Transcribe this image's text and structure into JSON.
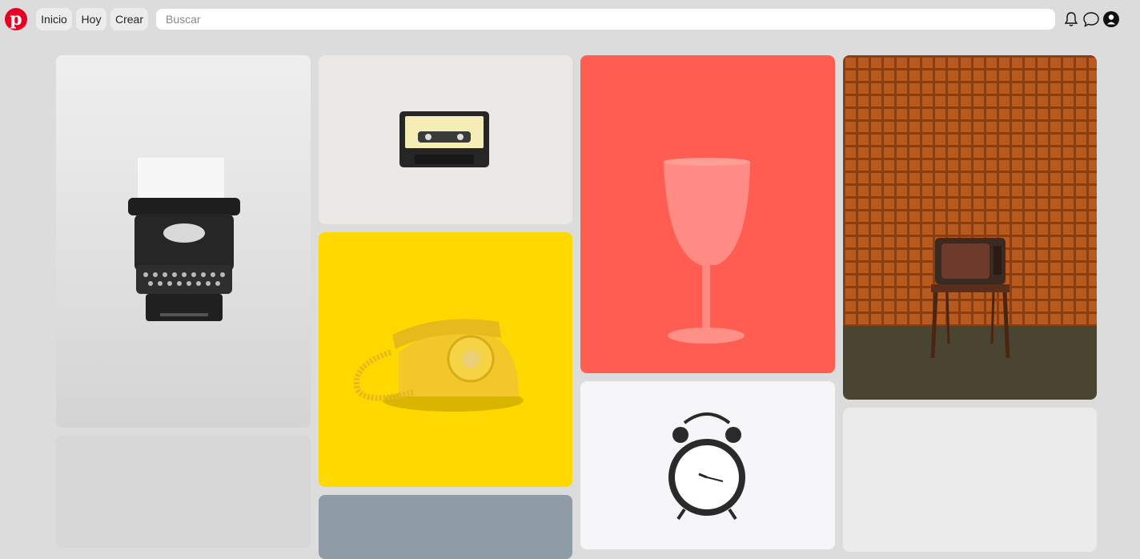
{
  "header": {
    "logo_letter": "p",
    "nav": [
      {
        "label": "Inicio"
      },
      {
        "label": "Hoy"
      },
      {
        "label": "Crear"
      }
    ],
    "search": {
      "placeholder": "Buscar",
      "value": ""
    },
    "icons": [
      "bell-icon",
      "chat-bubble-icon",
      "profile-avatar-icon"
    ]
  },
  "pins": [
    {
      "subject": "typewriter",
      "color": "#e6e6e6"
    },
    {
      "subject": "cassette-tape",
      "color": "#ece9e7"
    },
    {
      "subject": "yellow-rotary-phone",
      "color": "#ffd800"
    },
    {
      "subject": "pink-wine-glass",
      "color": "#ff5d52"
    },
    {
      "subject": "retro-tv-on-chair",
      "color": "#b55a20"
    },
    {
      "subject": "alarm-clock",
      "color": "#f6f6f8"
    },
    {
      "subject": "light-grey",
      "color": "#dadada"
    },
    {
      "subject": "blue-grey",
      "color": "#8f9ba5"
    },
    {
      "subject": "light-grey-2",
      "color": "#ebebeb"
    }
  ],
  "colors": {
    "brand": "#e60023",
    "background": "#dcdcdc"
  }
}
